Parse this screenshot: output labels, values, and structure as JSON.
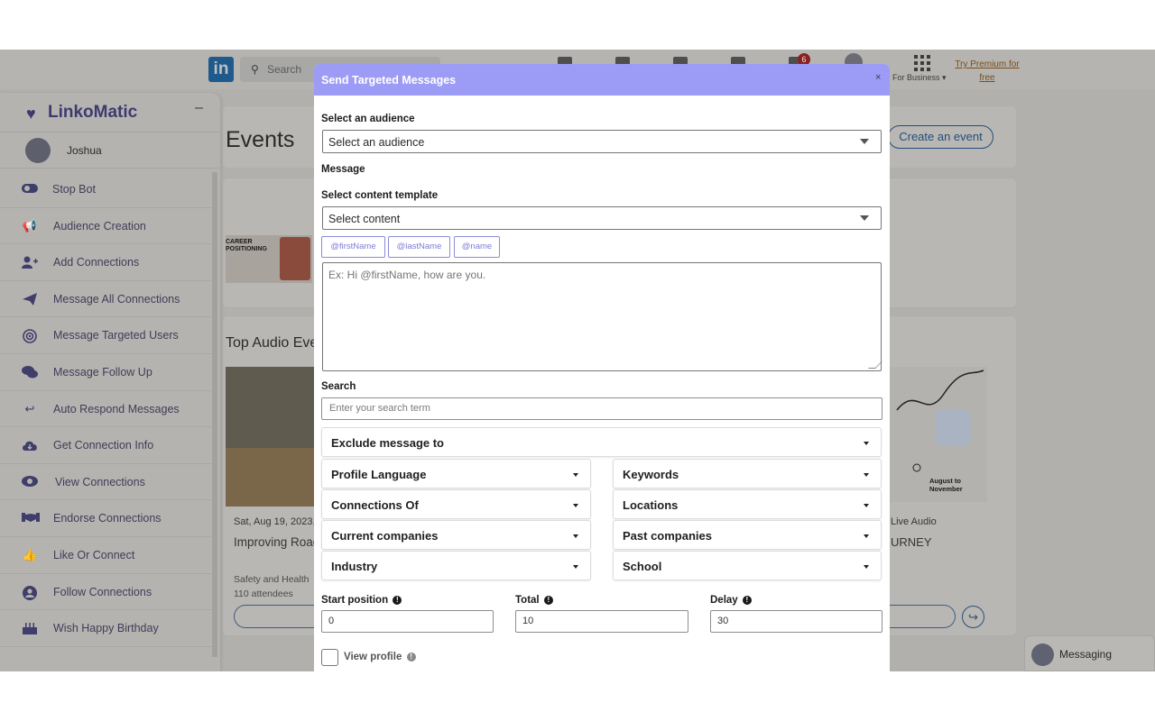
{
  "linkedin": {
    "logo": "in",
    "search_placeholder": "Search",
    "notifications_count": "6",
    "for_business": "For Business ▾",
    "premium": "Try Premium for free",
    "events_title": "Events",
    "create_event": "Create an event",
    "top_audio_events": "Top Audio Eve",
    "event_cards": [
      {
        "date": "Sat, Aug 19, 2023,",
        "title": "Improving Road",
        "organizer": "Safety and Health",
        "attendees": "110 attendees"
      },
      {
        "date": "Live Audio",
        "title": "URNEY"
      }
    ],
    "poster_text": "CAREER POSITIONING",
    "poster2_text": "August to November",
    "messaging": "Messaging"
  },
  "linkomatic": {
    "brand": "LinkoMatic",
    "minimize": "–",
    "user_name": "Joshua",
    "menu": [
      {
        "label": "Stop Bot",
        "icon": "toggle-icon"
      },
      {
        "label": "Audience Creation",
        "icon": "megaphone-icon"
      },
      {
        "label": "Add Connections",
        "icon": "user-plus-icon"
      },
      {
        "label": "Message All Connections",
        "icon": "paper-plane-icon"
      },
      {
        "label": "Message Targeted Users",
        "icon": "target-icon"
      },
      {
        "label": "Message Follow Up",
        "icon": "chat-bubbles-icon"
      },
      {
        "label": "Auto Respond Messages",
        "icon": "reply-icon"
      },
      {
        "label": "Get Connection Info",
        "icon": "cloud-download-icon"
      },
      {
        "label": "View Connections",
        "icon": "eye-icon"
      },
      {
        "label": "Endorse Connections",
        "icon": "handshake-icon"
      },
      {
        "label": "Like Or Connect",
        "icon": "thumbs-up-icon"
      },
      {
        "label": "Follow Connections",
        "icon": "user-circle-icon"
      },
      {
        "label": "Wish Happy Birthday",
        "icon": "cake-icon"
      }
    ]
  },
  "modal": {
    "title": "Send Targeted Messages",
    "close": "×",
    "audience_label": "Select an audience",
    "audience_value": "Select an audience",
    "message_label": "Message",
    "template_label": "Select content template",
    "template_value": "Select content",
    "chips": [
      "@firstName",
      "@lastName",
      "@name"
    ],
    "message_placeholder": "Ex: Hi @firstName, how are you.",
    "search_label": "Search",
    "search_placeholder": "Enter your search term",
    "exclude": "Exclude message to",
    "filters_left": [
      "Profile Language",
      "Connections Of",
      "Current companies",
      "Industry"
    ],
    "filters_right": [
      "Keywords",
      "Locations",
      "Past companies",
      "School"
    ],
    "start_label": "Start position",
    "start_value": "0",
    "total_label": "Total",
    "total_value": "10",
    "delay_label": "Delay",
    "delay_value": "30",
    "view_profile_label": "View profile",
    "info_glyph": "!"
  },
  "colors": {
    "modal_header": "#9c9cf7",
    "chip_accent": "#7b7bd6",
    "brand": "#3e3a6f"
  }
}
